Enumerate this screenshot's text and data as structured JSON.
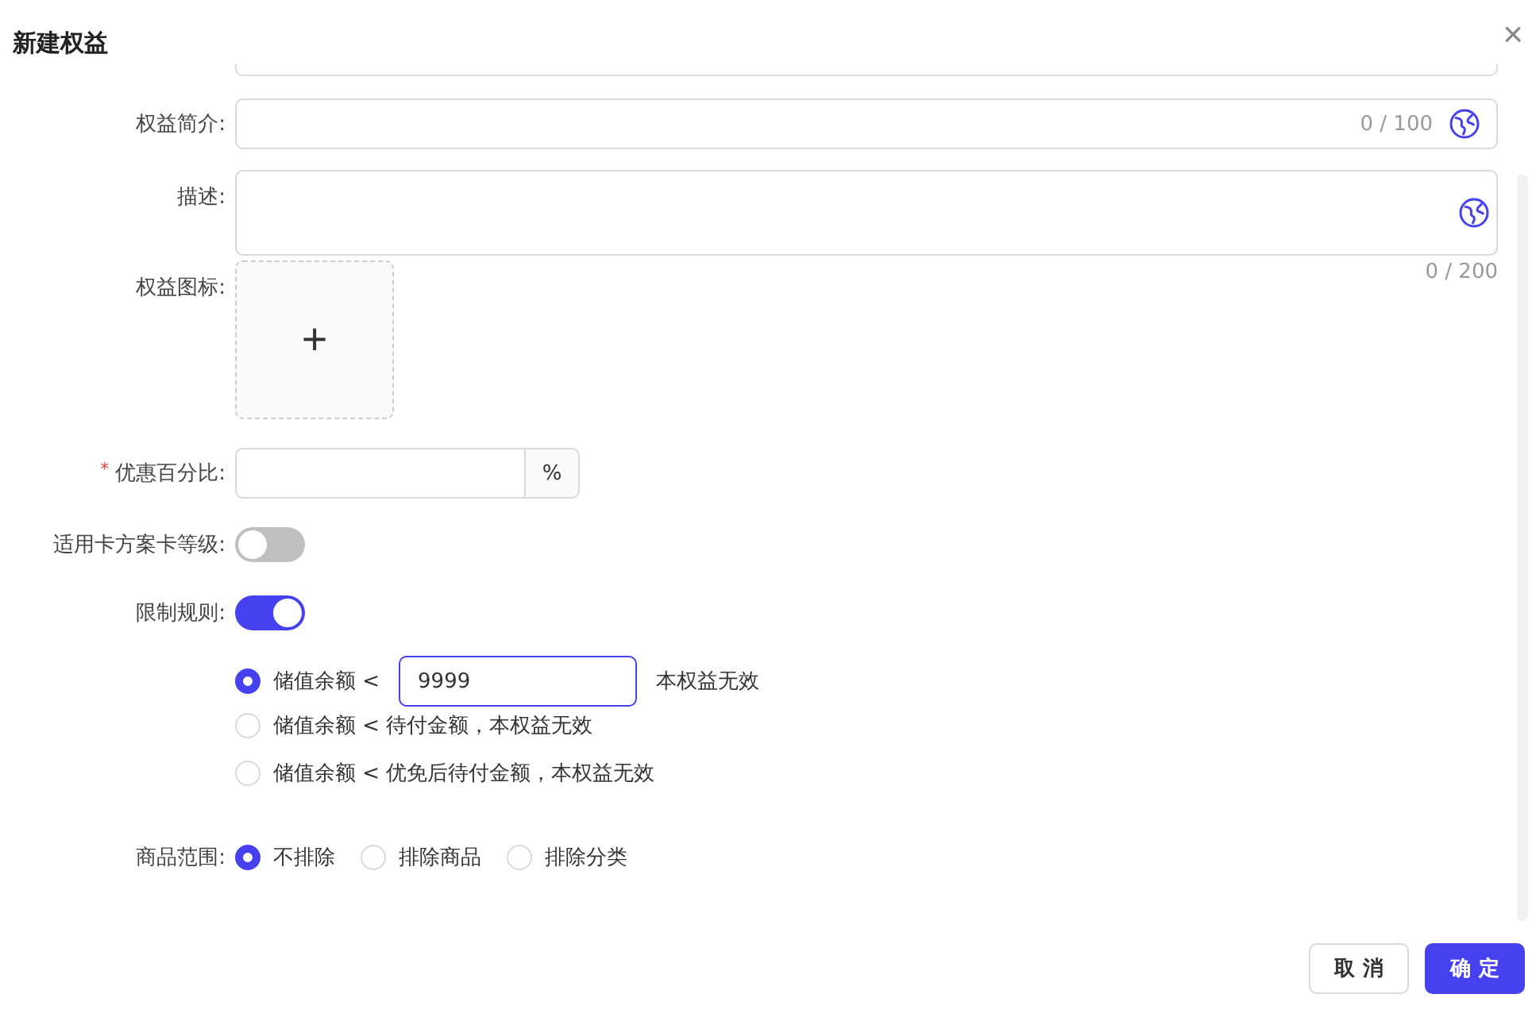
{
  "dialog": {
    "title": "新建权益",
    "close": "×"
  },
  "summary": {
    "label": "权益简介:",
    "counter": "0 / 100"
  },
  "description": {
    "label": "描述:",
    "counter": "0 / 200"
  },
  "icon_upload": {
    "label": "权益图标:",
    "plus": "+"
  },
  "discount": {
    "label": "优惠百分比:",
    "required": true,
    "required_mark": "*",
    "suffix": "%"
  },
  "switches": [
    {
      "label": "适用卡方案卡等级:",
      "on": false
    },
    {
      "label": "限制规则:",
      "on": true
    }
  ],
  "rules": [
    {
      "kind": "input",
      "label": "储值余额 <",
      "value": "9999",
      "suffix": "本权益无效",
      "selected": true
    },
    {
      "kind": "text",
      "label": "储值余额 < 待付金额，本权益无效",
      "selected": false
    },
    {
      "kind": "text",
      "label": "储值余额 < 优免后待付金额，本权益无效",
      "selected": false
    }
  ],
  "scope": {
    "label": "商品范围:",
    "options": [
      {
        "label": "不排除",
        "selected": true
      },
      {
        "label": "排除商品",
        "selected": false
      },
      {
        "label": "排除分类",
        "selected": false
      }
    ]
  },
  "buttons": [
    {
      "label": "取 消",
      "kind": "secondary"
    },
    {
      "label": "确 定",
      "kind": "primary"
    }
  ]
}
